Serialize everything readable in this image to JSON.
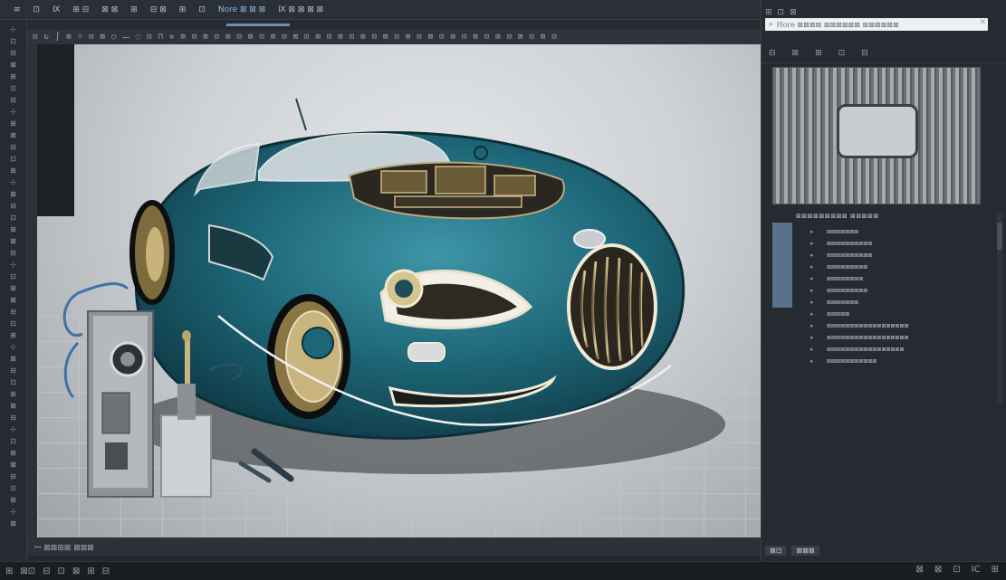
{
  "app": {
    "menu": [
      "≡",
      "⊡",
      "Ⅸ",
      "⊞ ⊟",
      "⊠ ⊠",
      "⊞",
      "⊟ ⊠",
      "⊞",
      "⊡",
      "Nore ⊠ ⊠ ⊠",
      "Ⅸ ⊠ ⊠ ⊠ ⊠"
    ],
    "active_menu_index": 9,
    "options_glyphs": [
      "⊡",
      "↻",
      "∫",
      "⊞",
      "☼",
      "⊟",
      "⊠",
      "○",
      "ꟷ",
      "◌",
      "⊡",
      "⊓",
      "✲",
      "⊞",
      "⊟",
      "⊠",
      "⊡",
      "⊞",
      "⊟",
      "⊠",
      "⊡",
      "⊞",
      "⊟",
      "⊠",
      "⊡",
      "⊞",
      "⊟",
      "⊠",
      "⊡",
      "⊞",
      "⊟",
      "⊠",
      "⊡",
      "⊞",
      "⊟",
      "⊠",
      "⊡",
      "⊞",
      "⊟",
      "⊠",
      "⊡",
      "⊞",
      "⊟",
      "⊠",
      "⊡",
      "⊞",
      "⊟"
    ],
    "status_text": "ꟷ ⊠⊠⊞⊠ ⊠⊠⊠"
  },
  "tools": [
    "⊹",
    "⊡",
    "⊟",
    "⊠",
    "⊞",
    "⊡",
    "⊟",
    "⊹",
    "⊞",
    "⊠",
    "⊟",
    "⊡",
    "⊞",
    "⊹",
    "⊠",
    "⊟",
    "⊡",
    "⊞",
    "⊠",
    "⊟",
    "⊹",
    "⊡",
    "⊞",
    "⊠",
    "⊟",
    "⊡",
    "⊞",
    "⊹",
    "⊠",
    "⊟",
    "⊡",
    "⊞",
    "⊠",
    "⊟",
    "⊹",
    "⊡",
    "⊞",
    "⊠",
    "⊟",
    "⊡",
    "⊞",
    "⊹",
    "⊠"
  ],
  "right_panel": {
    "search_placeholder": "Hore ⊠⊠⊠⊠ ⊠⊠⊠⊠⊠⊠ ⊠⊠⊠⊠⊠⊠",
    "top_glyphs": [
      "⊞",
      "⊡",
      "⊠"
    ],
    "toolbar_glyphs": [
      "⊟",
      "⊠",
      "⊞",
      "⊡",
      "⊟"
    ],
    "layers_title": "⊠⊠⊠⊠⊠⊠⊠⊠⊠ ⊠⊠⊠⊠⊠",
    "layers": [
      "⊠⊠⊠⊠⊠⊠⊠",
      "⊠⊠⊠⊠⊠⊠⊠⊠⊠⊠",
      "⊠⊠⊠⊠⊠⊠⊠⊠⊠⊠",
      "⊠⊠⊠⊠⊠⊠⊠⊠⊠",
      "⊠⊠⊠⊠⊠⊠⊠⊠",
      "⊠⊠⊠⊠⊠⊠⊠⊠⊠",
      "⊠⊠⊠⊠⊠⊠⊠",
      "⊠⊠⊠⊠⊠",
      "⊠⊠⊠⊠⊠⊠⊠⊠⊠⊠⊠⊠⊠⊠⊠⊠⊠⊠",
      "⊠⊠⊠⊠⊠⊠⊠⊠⊠⊠⊠⊠⊠⊠⊠⊠⊠⊠",
      "⊠⊠⊠⊠⊠⊠⊠⊠⊠⊠⊠⊠⊠⊠⊠⊠⊠",
      "⊠⊠⊠⊠⊠⊠⊠⊠⊠⊠⊠"
    ],
    "bottom_buttons": [
      "⊠⊡",
      "⊠⊠⊠"
    ]
  },
  "taskbar": {
    "left": [
      "⊞",
      "⊠⊡",
      "⊟",
      "⊡",
      "⊠",
      "⊞",
      "⊟"
    ],
    "right": [
      "⊠",
      "⊠",
      "⊡",
      "IC",
      "⊞"
    ]
  },
  "colors": {
    "accent": "#6f90b5",
    "car_body": "#1f6e7f",
    "car_trim": "#d8c898"
  }
}
